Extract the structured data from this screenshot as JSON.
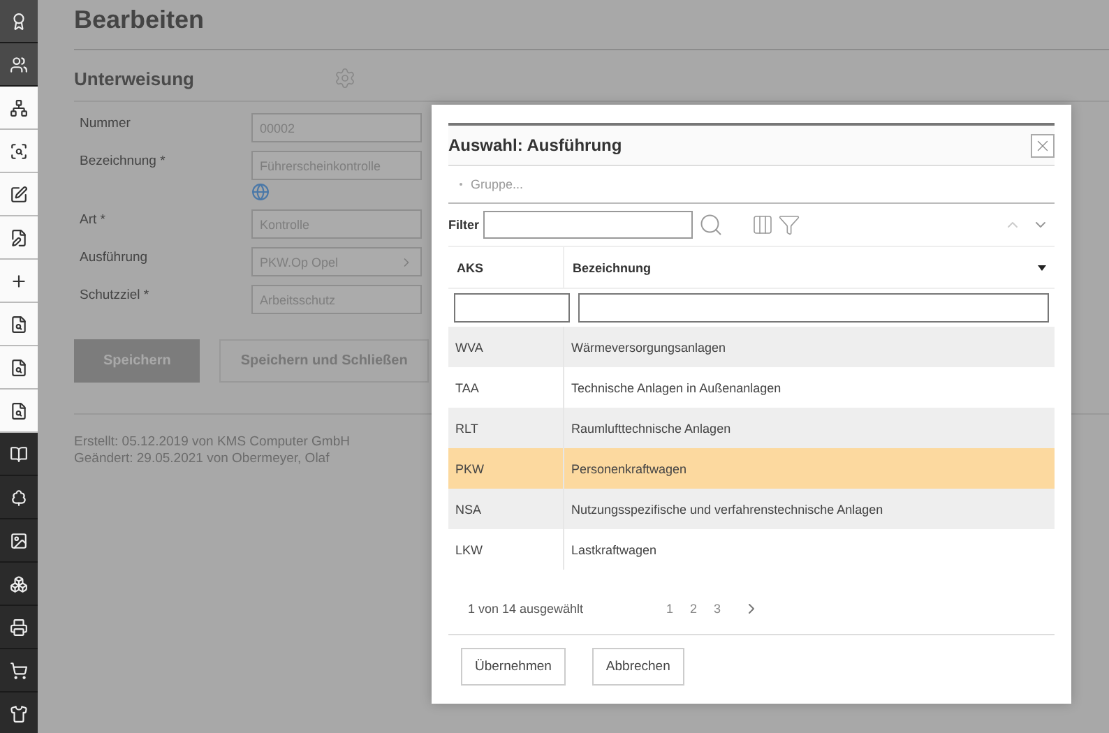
{
  "page": {
    "title": "Bearbeiten",
    "section": "Unterweisung"
  },
  "form": [
    {
      "label": "Nummer",
      "value": "00002",
      "kind": "text"
    },
    {
      "label": "Bezeichnung *",
      "value": "Führerscheinkontrolle",
      "kind": "translatable"
    },
    {
      "label": "Art *",
      "value": "Kontrolle",
      "kind": "text"
    },
    {
      "label": "Ausführung",
      "value": "PKW.Op Opel",
      "kind": "picker"
    },
    {
      "label": "Schutzziel *",
      "value": "Arbeitsschutz",
      "kind": "text"
    }
  ],
  "buttons": [
    {
      "label": "Speichern",
      "kind": "primary"
    },
    {
      "label": "Speichern und Schließen",
      "kind": "secondary"
    }
  ],
  "footer": [
    "Erstellt: 05.12.2019 von KMS Computer GmbH",
    "Geändert: 29.05.2021 von Obermeyer, Olaf"
  ],
  "dialog": {
    "title": "Auswahl: Ausführung",
    "group": "Gruppe...",
    "filter_label": "Filter",
    "columns": [
      "AKS",
      "Bezeichnung"
    ],
    "rows": [
      {
        "aks": "WVA",
        "name": "Wärmeversorgungsanlagen",
        "selected": false
      },
      {
        "aks": "TAA",
        "name": "Technische Anlagen in Außenanlagen",
        "selected": false
      },
      {
        "aks": "RLT",
        "name": "Raumlufttechnische Anlagen",
        "selected": false
      },
      {
        "aks": "PKW",
        "name": "Personenkraftwagen",
        "selected": true
      },
      {
        "aks": "NSA",
        "name": "Nutzungsspezifische und verfahrenstechnische Anlagen",
        "selected": false
      },
      {
        "aks": "LKW",
        "name": "Lastkraftwagen",
        "selected": false
      }
    ],
    "status": "1 von 14 ausgewählt",
    "pages": [
      "1",
      "2",
      "3"
    ],
    "buttons": [
      "Übernehmen",
      "Abbrechen"
    ]
  }
}
